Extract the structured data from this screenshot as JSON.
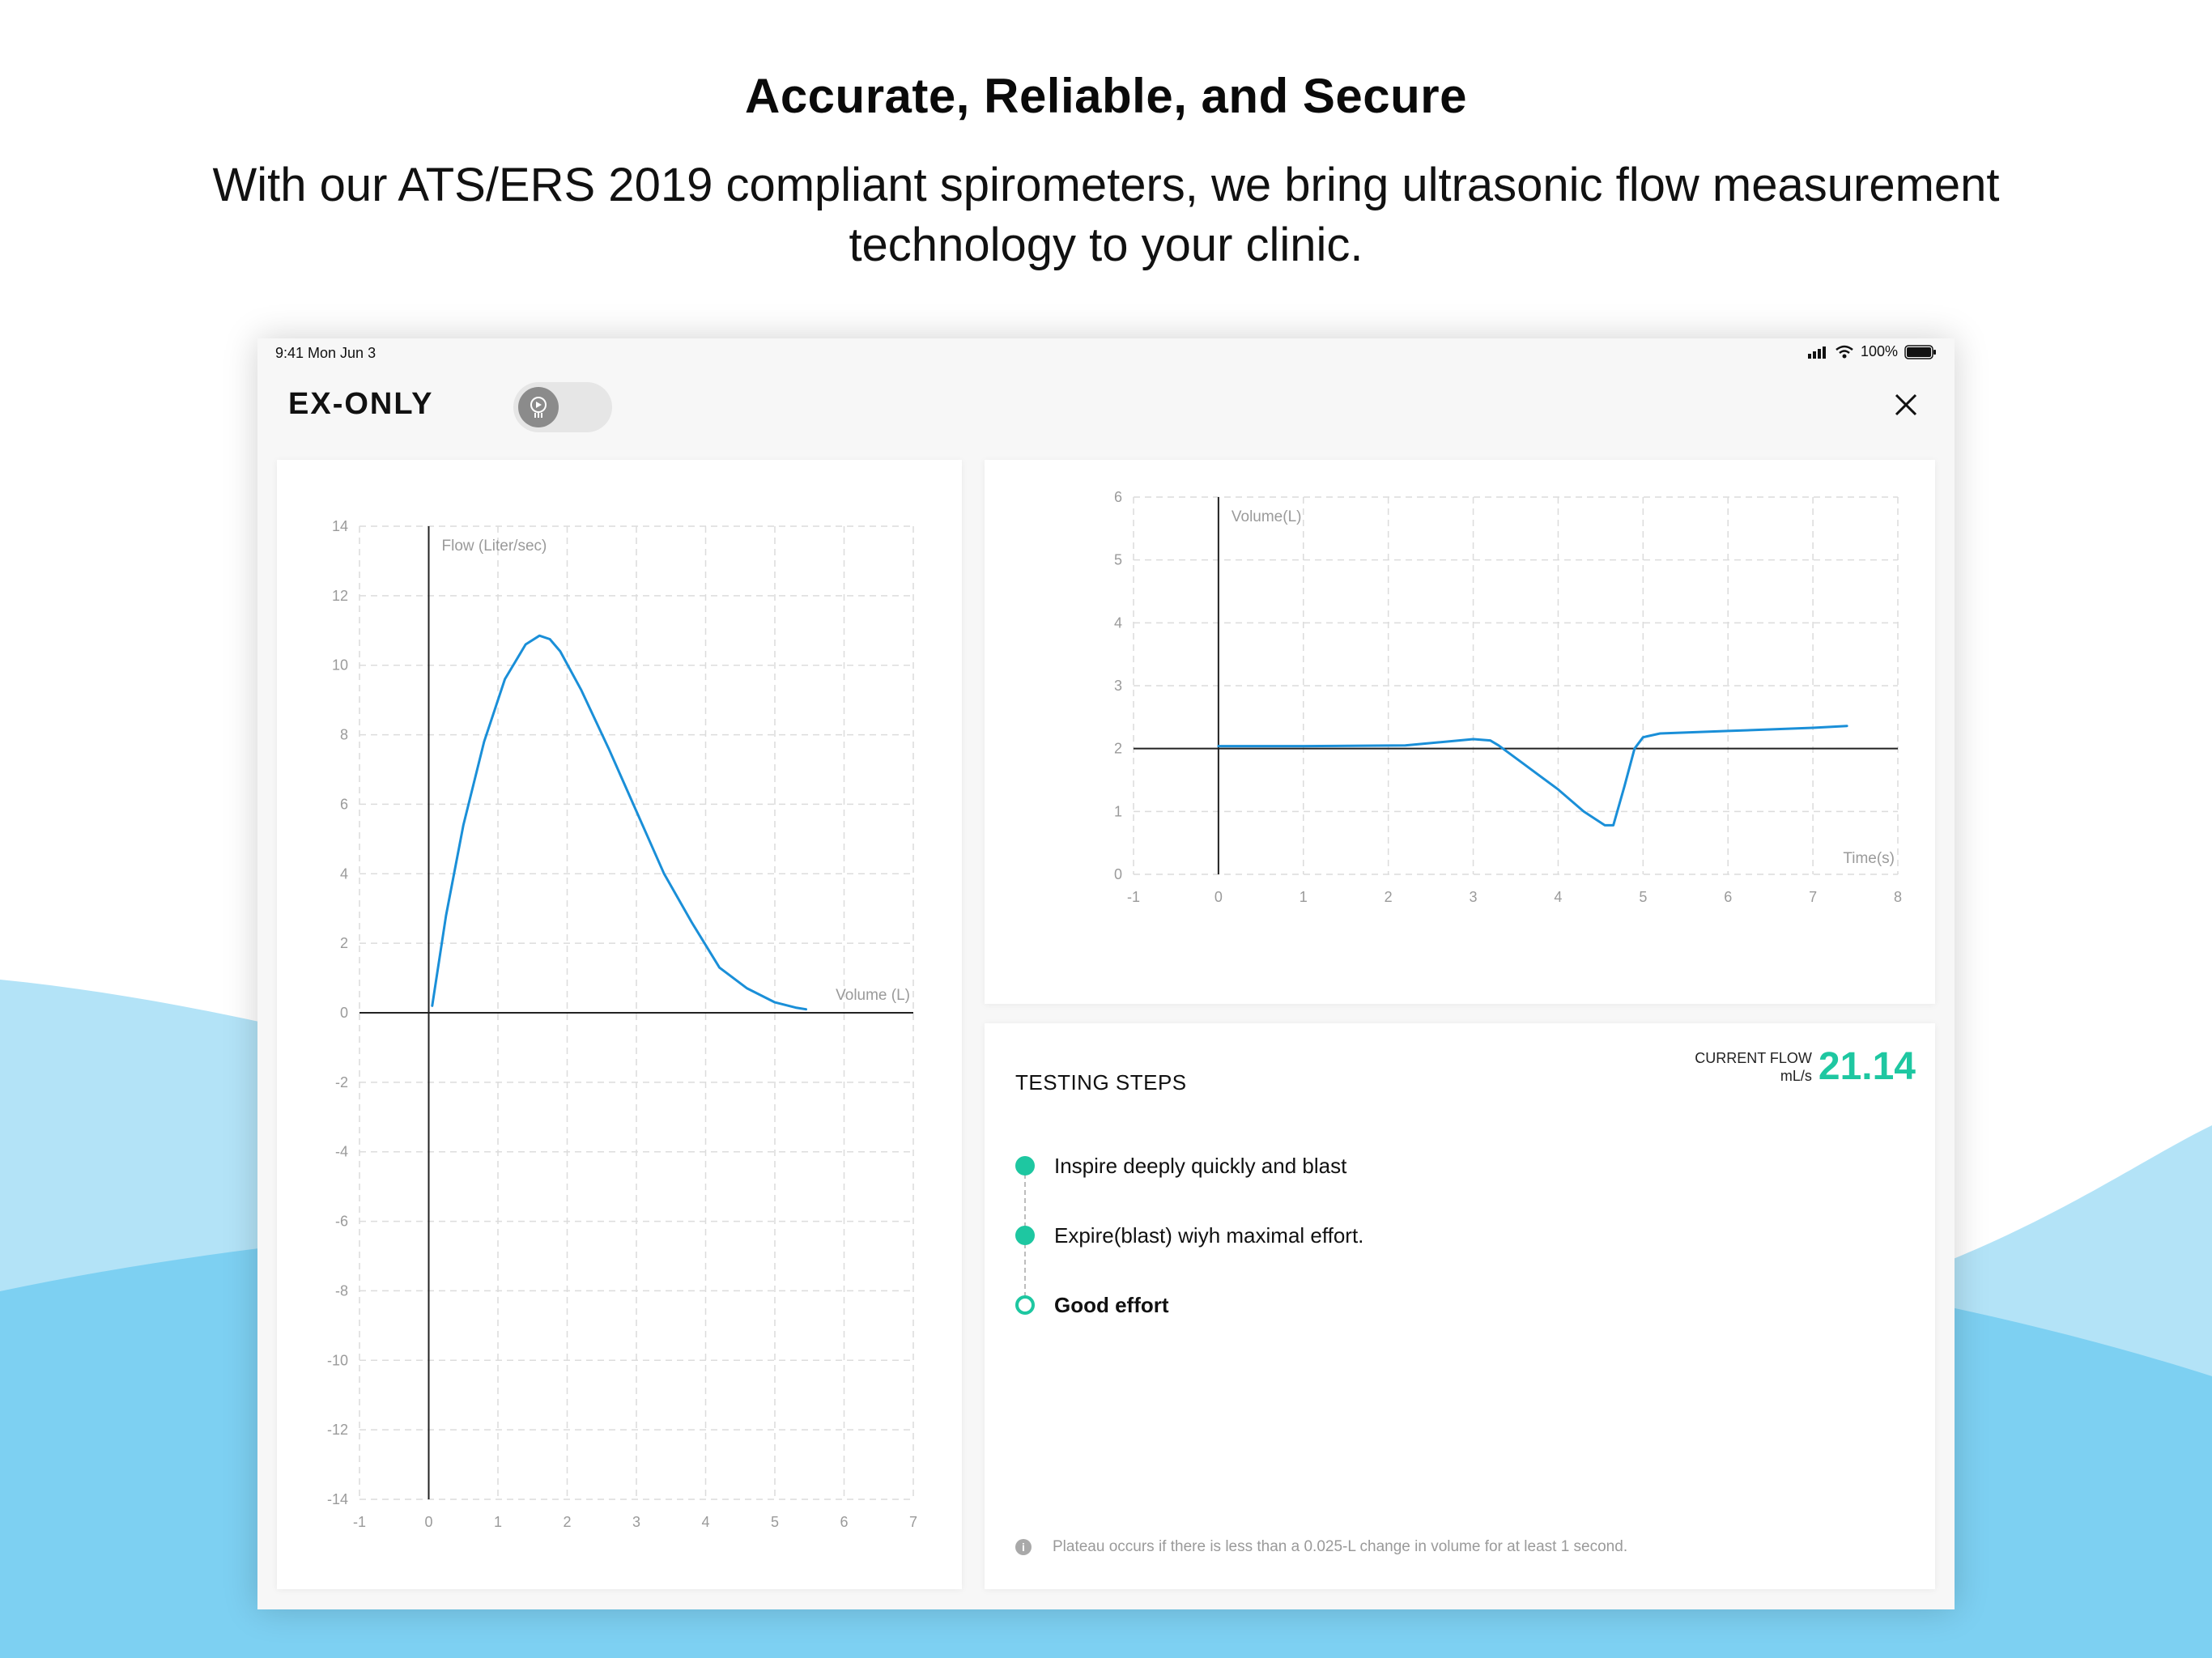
{
  "marketing": {
    "headline": "Accurate, Reliable, and Secure",
    "subheadline": "With our ATS/ERS 2019 compliant spirometers, we bring ultrasonic flow measurement technology to your clinic."
  },
  "status_bar": {
    "time": "9:41  Mon Jun 3",
    "battery": "100%"
  },
  "app": {
    "title": "EX-ONLY",
    "toggle_state": "off",
    "toggle_icon": "spirometer-icon",
    "close_icon": "close-icon"
  },
  "steps_panel": {
    "title": "TESTING STEPS",
    "current_flow_label": "CURRENT FLOW",
    "current_flow_unit": "mL/s",
    "current_flow_value": "21.14",
    "steps": [
      {
        "label": "Inspire deeply quickly and blast",
        "state": "done"
      },
      {
        "label": "Expire(blast) wiyh maximal effort.",
        "state": "done"
      },
      {
        "label": "Good effort",
        "state": "current"
      }
    ],
    "footnote": "Plateau occurs if there is less than a 0.025-L change in volume for at least 1 second."
  },
  "colors": {
    "accent": "#1ec7a1",
    "curve": "#1a8fd8",
    "wave_light": "#b3e3f7",
    "wave_dark": "#7dd0f2"
  },
  "chart_data": [
    {
      "type": "line",
      "ylabel": "Flow (Liter/sec)",
      "xlabel": "Volume (L)",
      "xlim": [
        -1,
        7
      ],
      "ylim": [
        -14,
        14
      ],
      "x_ticks": [
        -1,
        0,
        1,
        2,
        3,
        4,
        5,
        6,
        7
      ],
      "y_ticks": [
        -14,
        -12,
        -10,
        -8,
        -6,
        -4,
        -2,
        0,
        2,
        4,
        6,
        8,
        10,
        12,
        14
      ],
      "grid": true,
      "series": [
        {
          "x": [
            0.05,
            0.25,
            0.5,
            0.8,
            1.1,
            1.4,
            1.6,
            1.75,
            1.9,
            2.2,
            2.6,
            3.0,
            3.4,
            3.8,
            4.2,
            4.6,
            5.0,
            5.3,
            5.45
          ],
          "y": [
            0.2,
            2.8,
            5.4,
            7.8,
            9.6,
            10.6,
            10.85,
            10.75,
            10.4,
            9.3,
            7.6,
            5.8,
            4.0,
            2.6,
            1.3,
            0.7,
            0.3,
            0.15,
            0.1
          ]
        }
      ]
    },
    {
      "type": "line",
      "ylabel": "Volume(L)",
      "xlabel": "Time(s)",
      "xlim": [
        -1,
        8
      ],
      "ylim": [
        0,
        6
      ],
      "x_ticks": [
        -1,
        0,
        1,
        2,
        3,
        4,
        5,
        6,
        7,
        8
      ],
      "y_ticks": [
        0,
        1,
        2,
        3,
        4,
        5,
        6
      ],
      "grid": true,
      "series": [
        {
          "x": [
            0,
            1.0,
            2.2,
            2.6,
            3.0,
            3.2,
            3.3,
            3.6,
            4.0,
            4.3,
            4.55,
            4.65,
            4.78,
            4.9,
            5.0,
            5.2,
            6.0,
            7.0,
            7.4
          ],
          "y": [
            2.04,
            2.04,
            2.05,
            2.1,
            2.15,
            2.13,
            2.05,
            1.75,
            1.35,
            1.0,
            0.78,
            0.78,
            1.4,
            2.0,
            2.18,
            2.24,
            2.28,
            2.33,
            2.36
          ]
        }
      ]
    }
  ]
}
